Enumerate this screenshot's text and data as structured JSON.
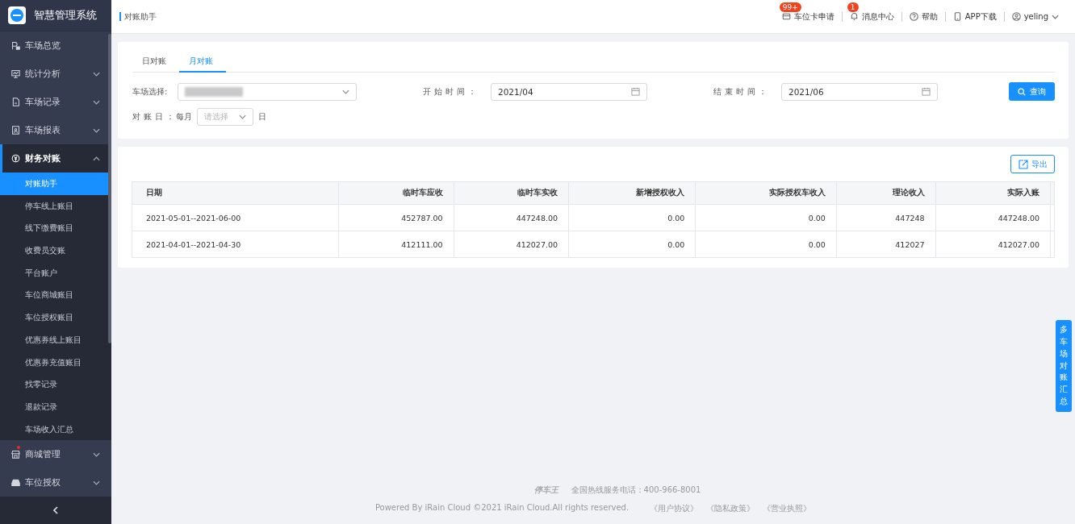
{
  "sidebar": {
    "title": "智慧管理系统",
    "menu": [
      {
        "label": "车场总览",
        "kind": "link"
      },
      {
        "label": "统计分析",
        "kind": "group",
        "expanded": false
      },
      {
        "label": "车场记录",
        "kind": "group",
        "expanded": false
      },
      {
        "label": "车场报表",
        "kind": "group",
        "expanded": false
      },
      {
        "label": "财务对账",
        "kind": "group",
        "expanded": true,
        "children": [
          {
            "label": "对账助手",
            "selected": true
          },
          {
            "label": "停车线上账目",
            "selected": false
          },
          {
            "label": "线下缴费账目",
            "selected": false
          },
          {
            "label": "收费员交账",
            "selected": false
          },
          {
            "label": "平台账户",
            "selected": false
          },
          {
            "label": "车位商城账目",
            "selected": false
          },
          {
            "label": "车位授权账目",
            "selected": false
          },
          {
            "label": "优惠券线上账目",
            "selected": false
          },
          {
            "label": "优惠券充值账目",
            "selected": false
          },
          {
            "label": "找零记录",
            "selected": false
          },
          {
            "label": "退款记录",
            "selected": false
          },
          {
            "label": "车场收入汇总",
            "selected": false
          }
        ]
      },
      {
        "label": "商城管理",
        "kind": "group",
        "expanded": false,
        "dot": true
      },
      {
        "label": "车位授权",
        "kind": "group",
        "expanded": false
      }
    ]
  },
  "header": {
    "breadcrumb": "对账助手",
    "nav": [
      {
        "label": "车位卡申请",
        "badge": "99+"
      },
      {
        "label": "消息中心",
        "badge": "1"
      },
      {
        "label": "帮助"
      },
      {
        "label": "APP下载"
      },
      {
        "label": "yeling",
        "dropdown": true
      }
    ]
  },
  "tabs": [
    {
      "label": "日对账",
      "selected": false
    },
    {
      "label": "月对账",
      "selected": true
    }
  ],
  "filters": {
    "park_label": "车场选择:",
    "start_label": "开始时间：",
    "start_value": "2021/04",
    "end_label": "结束时间：",
    "end_value": "2021/06",
    "query_button": "查询",
    "day_label": "对账日：",
    "day_prefix": "每月",
    "day_placeholder": "请选择",
    "day_suffix": "日"
  },
  "export_button": "导出",
  "table": {
    "columns": [
      "日期",
      "临时车应收",
      "临时车实收",
      "新增授权收入",
      "实际授权车收入",
      "理论收入",
      "实际入账"
    ],
    "rows": [
      [
        "2021-05-01--2021-06-00",
        "452787.00",
        "447248.00",
        "0.00",
        "0.00",
        "447248",
        "447248.00"
      ],
      [
        "2021-04-01--2021-04-30",
        "412111.00",
        "412027.00",
        "0.00",
        "0.00",
        "412027",
        "412027.00"
      ]
    ]
  },
  "side_button": "多车场对账汇总",
  "footer": {
    "brand": "停车王",
    "hotline": "全国热线服务电话：400-966-8001",
    "copyright": "Powered By iRain Cloud ©2021 iRain Cloud.All rights reserved.",
    "links": [
      "《用户协议》",
      "《隐私政策》",
      "《营业执照》"
    ]
  }
}
